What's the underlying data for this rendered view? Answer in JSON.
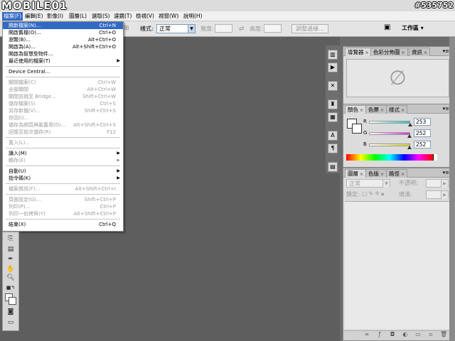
{
  "window": {
    "logo": "MOBILE01",
    "watermark": "#535752"
  },
  "menubar": {
    "items": [
      "檔案(F)",
      "編輯(E)",
      "影像(I)",
      "圖層(L)",
      "選取(S)",
      "濾鏡(T)",
      "檢視(V)",
      "視窗(W)",
      "說明(H)"
    ]
  },
  "options": {
    "style_label": "樣式:",
    "style_value": "正常",
    "width_label": "寬度:",
    "height_label": "高度:",
    "refine_edge": "調整邊緣...",
    "workspace": "工作區 ▾"
  },
  "file_menu": {
    "items": [
      {
        "label": "開新檔案(N)...",
        "shortcut": "Ctrl+N",
        "state": "highlighted"
      },
      {
        "label": "開啟舊檔(O)...",
        "shortcut": "Ctrl+O",
        "state": "enabled"
      },
      {
        "label": "瀏覽(B)...",
        "shortcut": "Alt+Ctrl+O",
        "state": "enabled"
      },
      {
        "label": "開啟為(A)...",
        "shortcut": "Alt+Shift+Ctrl+O",
        "state": "enabled"
      },
      {
        "label": "開啟為智慧型物件...",
        "shortcut": "",
        "state": "enabled"
      },
      {
        "label": "最近使用的檔案(T)",
        "shortcut": "",
        "state": "submenu"
      },
      {
        "separator": true
      },
      {
        "label": "Device Central...",
        "shortcut": "",
        "state": "enabled"
      },
      {
        "separator": true
      },
      {
        "label": "關閉檔案(C)",
        "shortcut": "Ctrl+W",
        "state": "disabled"
      },
      {
        "label": "全部關閉",
        "shortcut": "Alt+Ctrl+W",
        "state": "disabled"
      },
      {
        "label": "關閉並跳至 Bridge...",
        "shortcut": "Shift+Ctrl+W",
        "state": "disabled"
      },
      {
        "label": "儲存檔案(S)",
        "shortcut": "Ctrl+S",
        "state": "disabled"
      },
      {
        "label": "另存新檔(V)...",
        "shortcut": "Shift+Ctrl+S",
        "state": "disabled"
      },
      {
        "label": "存回(I)...",
        "shortcut": "",
        "state": "disabled"
      },
      {
        "label": "儲存為網頁與裝置用(D)...",
        "shortcut": "Alt+Shift+Ctrl+S",
        "state": "disabled"
      },
      {
        "label": "回復至前次儲存(R)",
        "shortcut": "F12",
        "state": "disabled"
      },
      {
        "separator": true
      },
      {
        "label": "置入(L)...",
        "shortcut": "",
        "state": "disabled"
      },
      {
        "separator": true
      },
      {
        "label": "讀入(M)",
        "shortcut": "",
        "state": "submenu"
      },
      {
        "label": "轉存(E)",
        "shortcut": "",
        "state": "submenu-disabled"
      },
      {
        "separator": true
      },
      {
        "label": "自動(U)",
        "shortcut": "",
        "state": "submenu"
      },
      {
        "label": "指令碼(K)",
        "shortcut": "",
        "state": "submenu"
      },
      {
        "separator": true
      },
      {
        "label": "檔案資訊(F)...",
        "shortcut": "Alt+Shift+Ctrl+I",
        "state": "disabled"
      },
      {
        "separator": true
      },
      {
        "label": "頁面設定(G)...",
        "shortcut": "Shift+Ctrl+P",
        "state": "disabled"
      },
      {
        "label": "列印(P)...",
        "shortcut": "Ctrl+P",
        "state": "disabled"
      },
      {
        "label": "列印一份拷貝(Y)",
        "shortcut": "Alt+Shift+Ctrl+P",
        "state": "disabled"
      },
      {
        "separator": true
      },
      {
        "label": "結束(X)",
        "shortcut": "Ctrl+Q",
        "state": "enabled"
      }
    ]
  },
  "navigator_panel": {
    "tabs": [
      "導覽器",
      "色彩分佈圖",
      "資訊"
    ],
    "empty_icon": "∅"
  },
  "color_panel": {
    "tabs": [
      "顏色",
      "色票",
      "樣式"
    ],
    "channels": [
      {
        "name": "R",
        "value": "253",
        "color": "#19c6c6",
        "fraction": 0.992
      },
      {
        "name": "G",
        "value": "252",
        "color": "#e12ad9",
        "fraction": 0.988
      },
      {
        "name": "B",
        "value": "252",
        "color": "#d6d620",
        "fraction": 0.988
      }
    ]
  },
  "layers_panel": {
    "tabs": [
      "圖層",
      "色版",
      "路徑"
    ],
    "blend_mode": "正常",
    "opacity_label": "不透明:",
    "lock_label": "鎖定:",
    "fill_label": "填滿:"
  }
}
